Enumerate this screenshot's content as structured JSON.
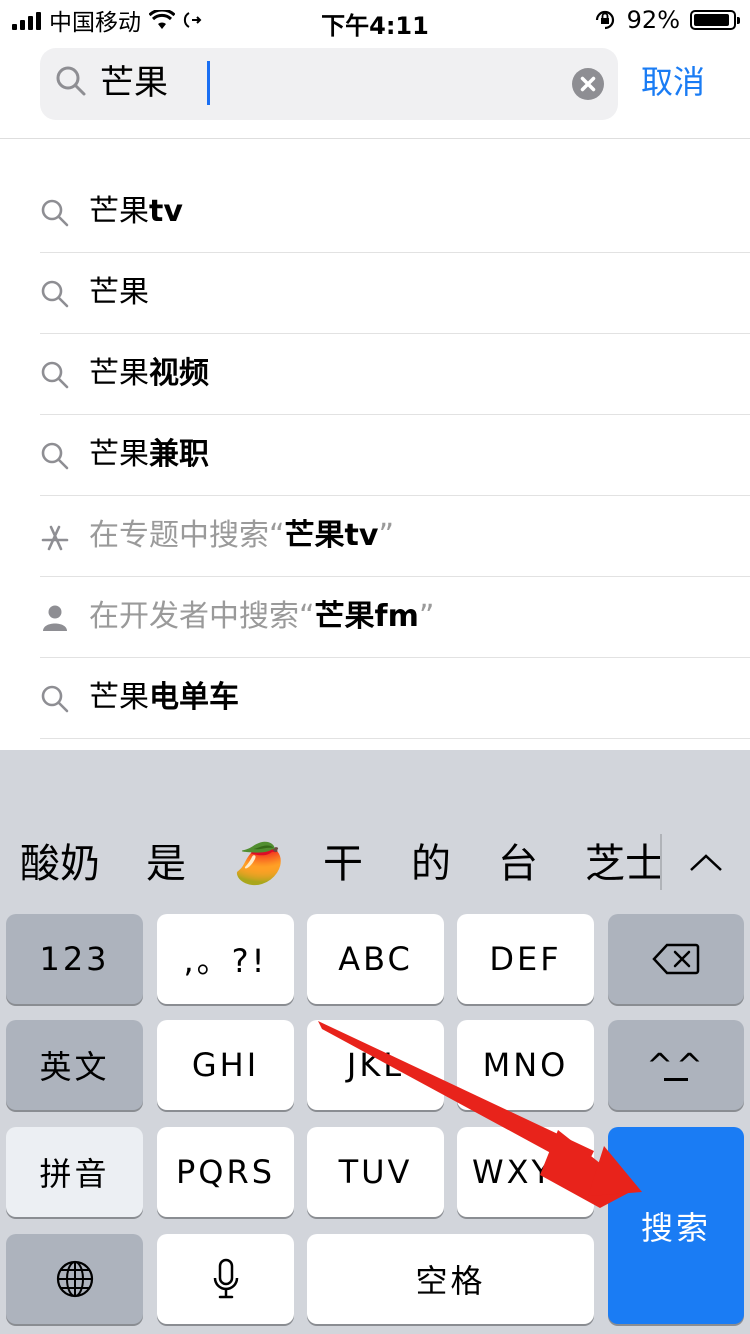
{
  "status": {
    "carrier": "中国移动",
    "time": "下午4:11",
    "battery": "92%",
    "battery_level": 0.92
  },
  "search": {
    "query": "芒果",
    "cancel_label": "取消"
  },
  "suggestions": [
    {
      "icon": "search-icon",
      "plain": "芒果",
      "bold": "tv"
    },
    {
      "icon": "search-icon",
      "plain": "芒果",
      "bold": ""
    },
    {
      "icon": "search-icon",
      "plain": "芒果",
      "bold": "视频"
    },
    {
      "icon": "search-icon",
      "plain": "芒果",
      "bold": "兼职"
    },
    {
      "icon": "app-store-icon",
      "gray": "在专题中搜索“",
      "bold": "芒果tv",
      "gray_end": "”"
    },
    {
      "icon": "person-icon",
      "gray": "在开发者中搜索“",
      "bold": "芒果fm",
      "gray_end": "”"
    },
    {
      "icon": "search-icon",
      "plain": "芒果",
      "bold": "电单车"
    }
  ],
  "candidates": [
    "酸奶",
    "是",
    "🥭",
    "干",
    "的",
    "台",
    "芝士"
  ],
  "keys": {
    "row1": [
      "123",
      ",。?!",
      "ABC",
      "DEF"
    ],
    "row2": [
      "英文",
      "GHI",
      "JKL",
      "MNO",
      "^^"
    ],
    "row3": [
      "拼音",
      "PQRS",
      "TUV",
      "WXYZ"
    ],
    "search_key": "搜索",
    "space": "空格"
  }
}
